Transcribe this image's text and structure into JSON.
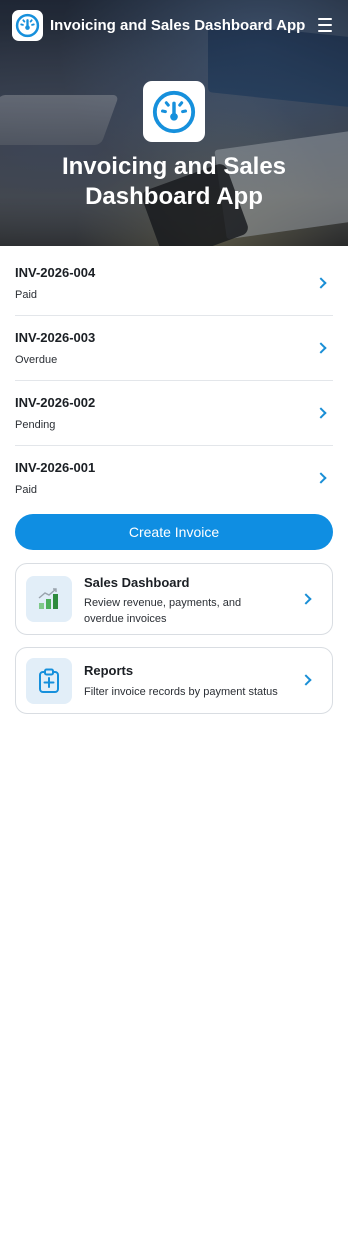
{
  "app": {
    "title": "Invoicing and Sales Dashboard App",
    "hero_title": "Invoicing and Sales Dashboard App",
    "accent_color": "#0f8ee2"
  },
  "header": {
    "logo_icon": "speedometer-icon",
    "menu_icon": "hamburger-menu-icon"
  },
  "invoices": [
    {
      "id": "INV-2026-004",
      "status": "Paid"
    },
    {
      "id": "INV-2026-003",
      "status": "Overdue"
    },
    {
      "id": "INV-2026-002",
      "status": "Pending"
    },
    {
      "id": "INV-2026-001",
      "status": "Paid"
    }
  ],
  "actions": {
    "create_invoice_label": "Create Invoice"
  },
  "cards": [
    {
      "title": "Sales Dashboard",
      "description": "Review revenue, payments, and overdue invoices",
      "icon": "bar-chart-trend-icon"
    },
    {
      "title": "Reports",
      "description": "Filter invoice records by payment status",
      "icon": "clipboard-plus-icon"
    }
  ]
}
